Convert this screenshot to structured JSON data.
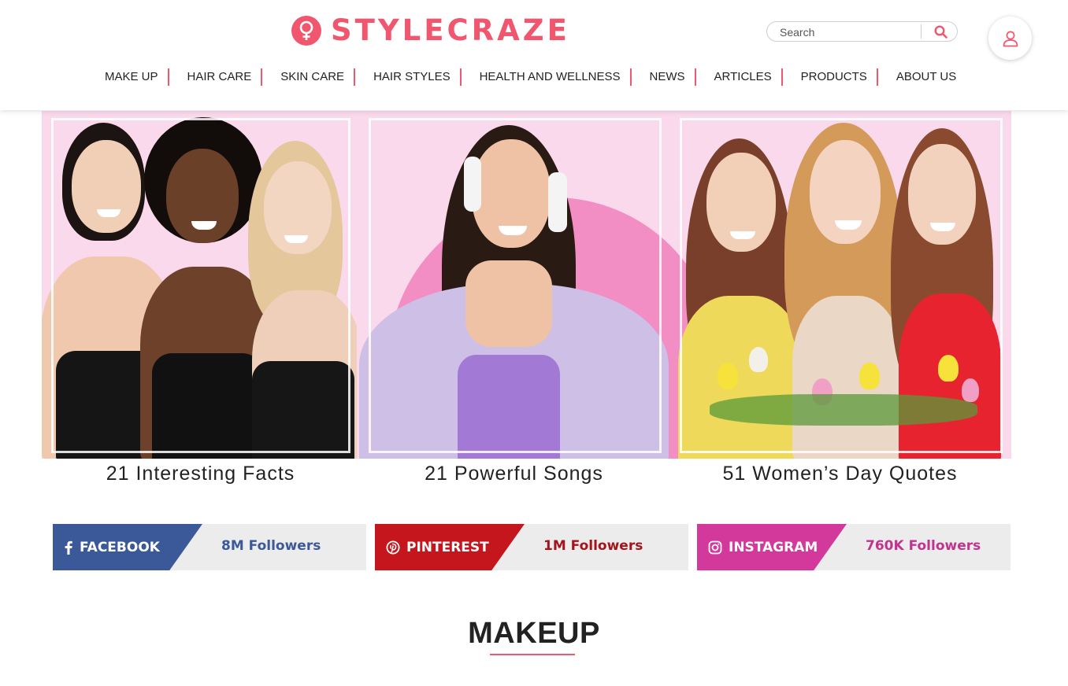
{
  "brand": {
    "logo_text": "STYLECRAZE",
    "accent_color": "#f0576e",
    "logo_icon": "female-symbol-icon"
  },
  "search": {
    "placeholder": "Search",
    "icon": "search-icon"
  },
  "user": {
    "icon": "user-icon"
  },
  "nav": {
    "items": [
      {
        "label": "MAKE UP"
      },
      {
        "label": "HAIR CARE"
      },
      {
        "label": "SKIN CARE"
      },
      {
        "label": "HAIR STYLES"
      },
      {
        "label": "HEALTH AND WELLNESS"
      },
      {
        "label": "NEWS"
      },
      {
        "label": "ARTICLES"
      },
      {
        "label": "PRODUCTS"
      },
      {
        "label": "ABOUT US"
      }
    ]
  },
  "hero": {
    "background_color": "#fbd9ec",
    "features": [
      {
        "title": "21 Interesting Facts"
      },
      {
        "title": "21 Powerful Songs"
      },
      {
        "title": "51 Women’s Day Quotes"
      }
    ]
  },
  "social": [
    {
      "name": "FACEBOOK",
      "followers": "8M Followers",
      "color": "#3b5998",
      "text_color": "#3b5998",
      "icon": "facebook-icon"
    },
    {
      "name": "PINTEREST",
      "followers": "1M Followers",
      "color": "#c4161c",
      "text_color": "#a3141b",
      "icon": "pinterest-icon"
    },
    {
      "name": "INSTAGRAM",
      "followers": "760K Followers",
      "color": "#d2399b",
      "text_color": "#c2338e",
      "icon": "instagram-icon"
    }
  ],
  "section": {
    "title": "MAKEUP"
  }
}
